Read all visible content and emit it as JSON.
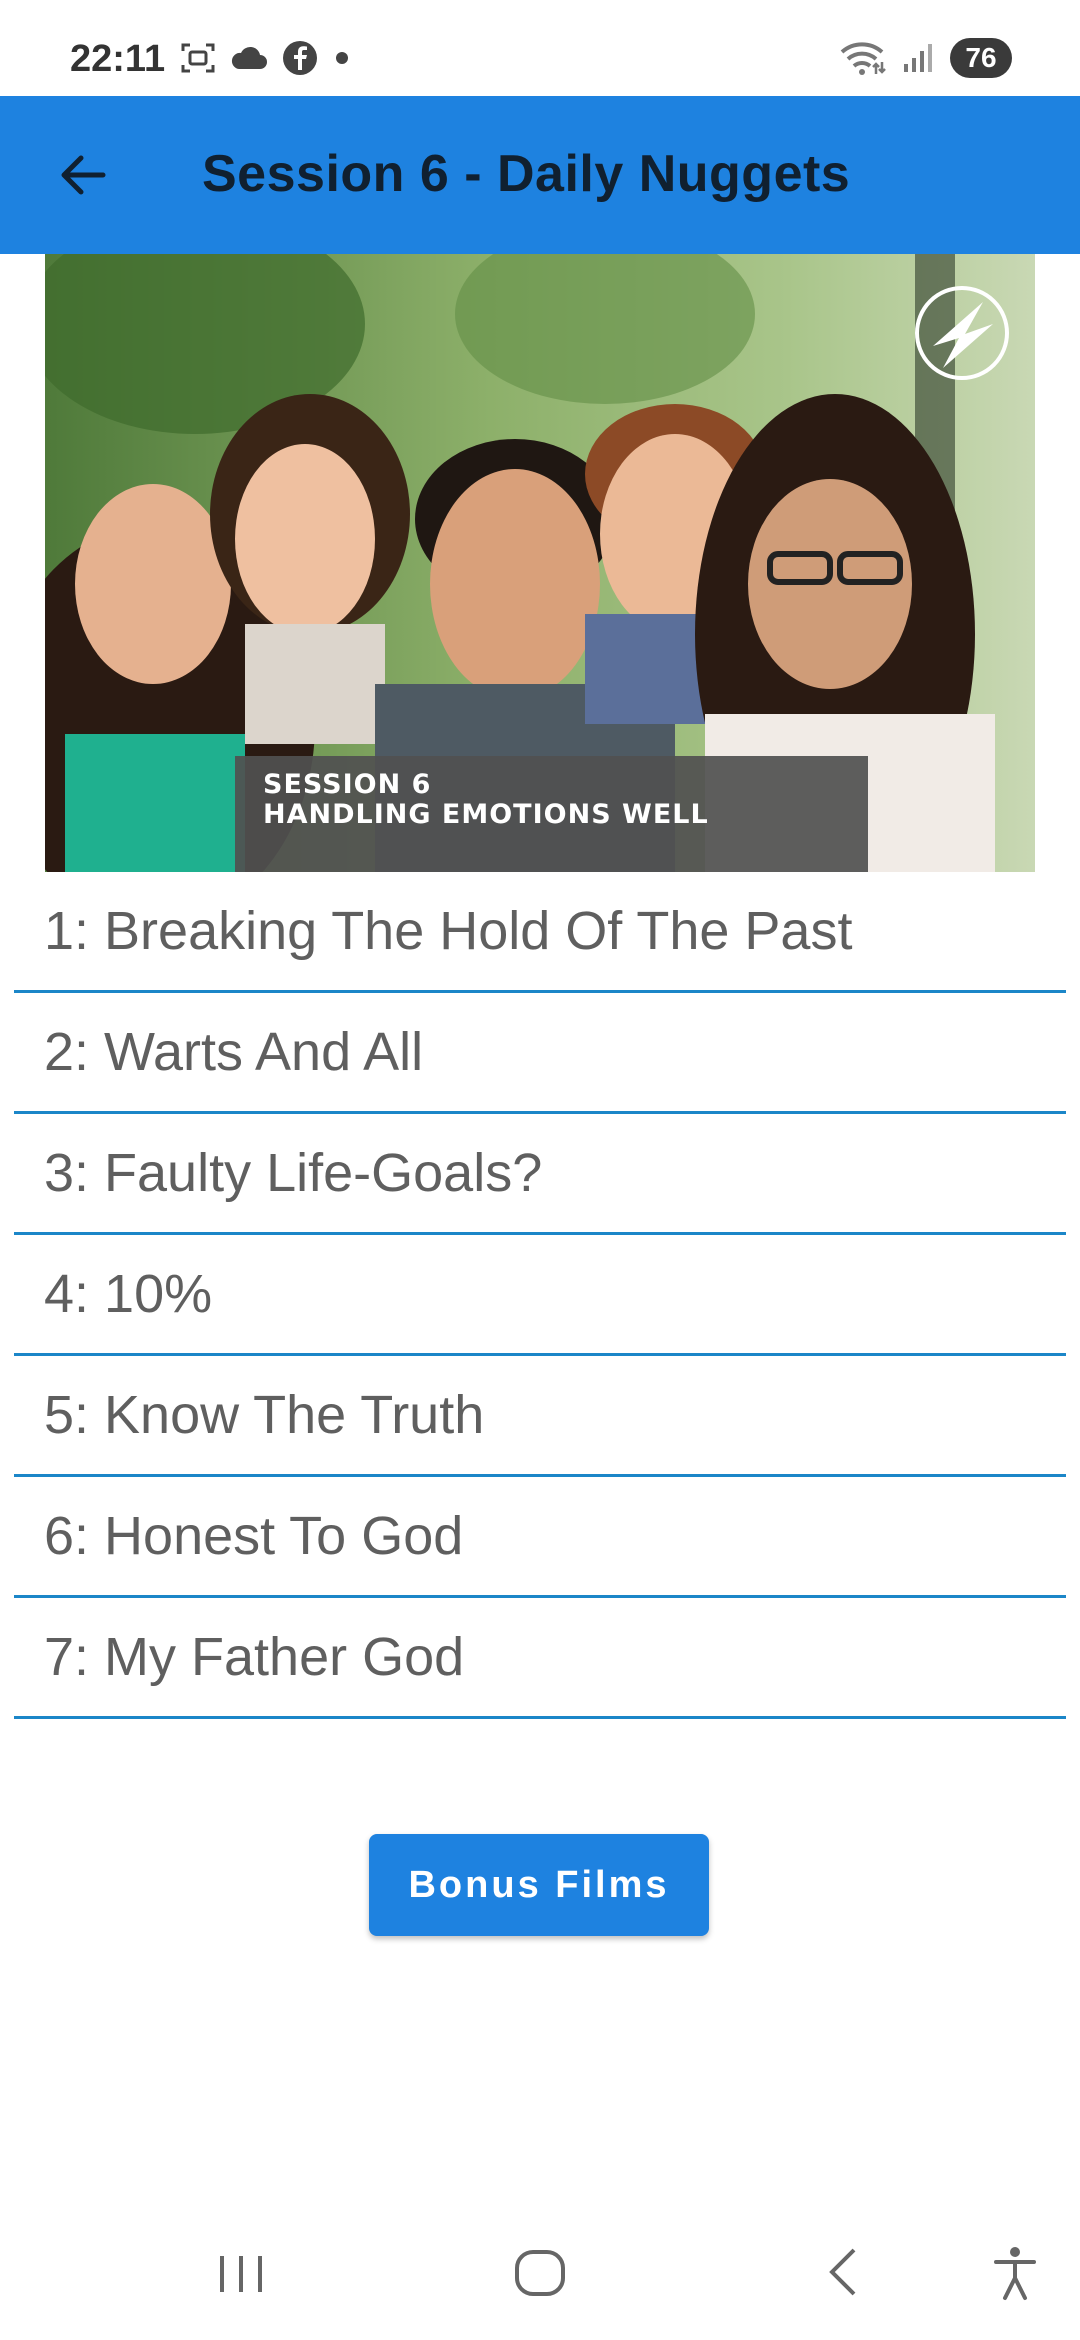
{
  "status_bar": {
    "time": "22:11",
    "battery": "76",
    "left_icons": [
      "screenshot-icon",
      "cloud-icon",
      "facebook-icon",
      "dot-icon"
    ],
    "right_icons": [
      "wifi-icon",
      "signal-icon"
    ]
  },
  "app_bar": {
    "title": "Session 6 - Daily Nuggets",
    "back_icon": "arrow-left-icon"
  },
  "hero": {
    "caption_line1": "SESSION 6",
    "caption_line2": "HANDLING EMOTIONS WELL"
  },
  "nuggets": [
    "1: Breaking The Hold Of The Past",
    "2: Warts And All",
    "3: Faulty Life-Goals?",
    "4: 10%",
    "5: Know The Truth",
    "6: Honest To God",
    "7: My Father God"
  ],
  "bonus_button": {
    "label": "Bonus Films"
  },
  "colors": {
    "accent": "#1e82e0",
    "divider": "#1b86c8",
    "text": "#5f5f5f"
  }
}
